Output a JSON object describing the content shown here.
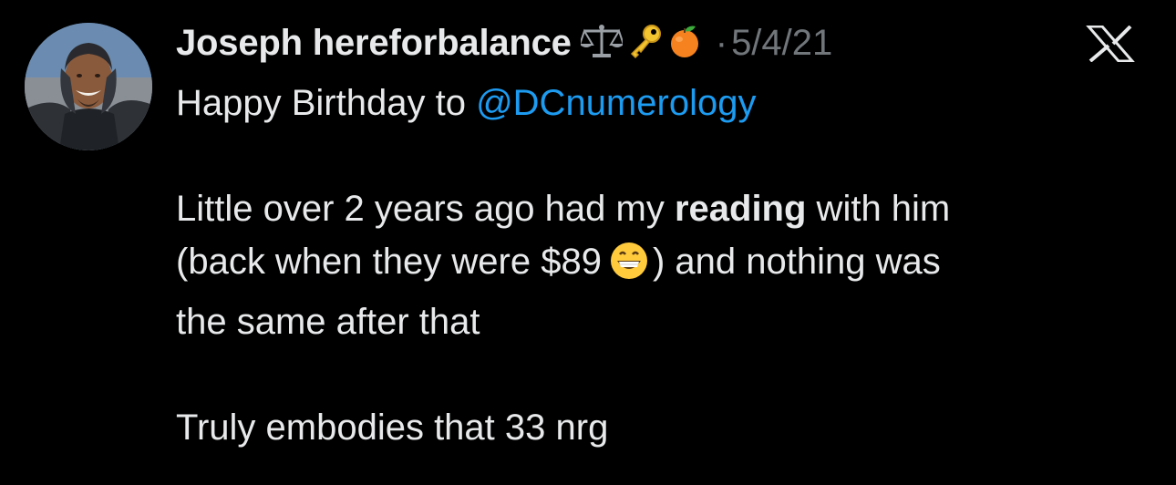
{
  "author": {
    "display_name": "Joseph hereforbalance",
    "name_emojis": [
      "balance-scale-icon",
      "key-icon",
      "tangerine-icon"
    ],
    "separator": "·",
    "date": "5/4/21"
  },
  "platform_icon": "x-logo-icon",
  "tweet": {
    "line1_prefix": "Happy Birthday to ",
    "mention": "@DCnumerology",
    "line2_prefix": "Little over 2 years ago had my ",
    "line2_bold": "reading",
    "line2_suffix": " with him",
    "line3_prefix": "(back when they were $89",
    "line3_emoji": "grinning-face-icon",
    "line3_suffix": ") and nothing was",
    "line4": "the same after that",
    "line5": "Truly embodies that 33 nrg"
  },
  "colors": {
    "background": "#000000",
    "text": "#e7e9ea",
    "secondary": "#71767b",
    "link": "#1d9bf0"
  }
}
